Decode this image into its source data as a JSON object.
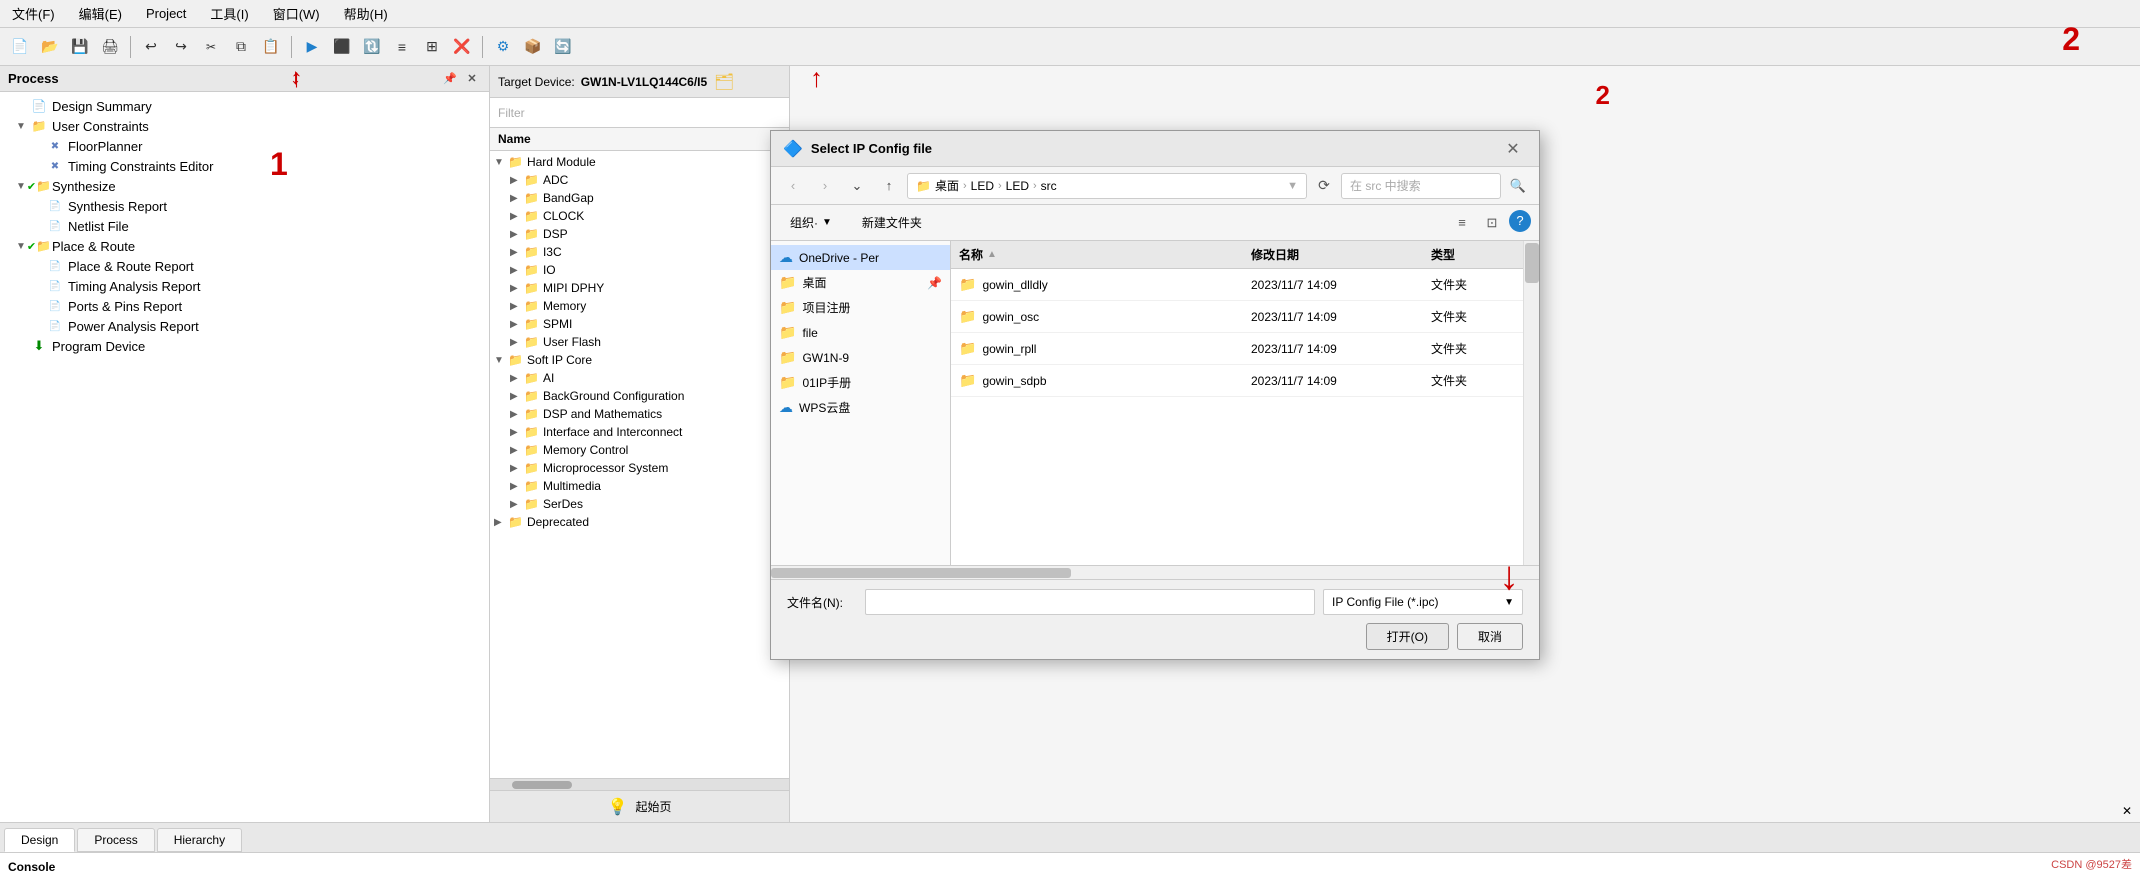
{
  "menu": {
    "items": [
      "文件(F)",
      "编辑(E)",
      "Project",
      "工具(I)",
      "窗口(W)",
      "帮助(H)"
    ]
  },
  "toolbar": {
    "buttons": [
      "📄",
      "📂",
      "💾",
      "🖨",
      "✂",
      "↩",
      "↪",
      "🔄",
      "🔲",
      "🔳",
      "📊",
      "📋",
      "❌",
      "⚙",
      "📦",
      "🔗",
      "🔃"
    ]
  },
  "left_panel": {
    "title": "Process",
    "tree": [
      {
        "id": "design-summary",
        "label": "Design Summary",
        "level": 1,
        "icon": "doc",
        "has_children": false
      },
      {
        "id": "user-constraints",
        "label": "User Constraints",
        "level": 1,
        "icon": "folder",
        "has_children": true,
        "expanded": true
      },
      {
        "id": "floorplanner",
        "label": "FloorPlanner",
        "level": 2,
        "icon": "file",
        "has_children": false
      },
      {
        "id": "timing-constraints",
        "label": "Timing Constraints Editor",
        "level": 2,
        "icon": "file",
        "has_children": false
      },
      {
        "id": "synthesize",
        "label": "Synthesize",
        "level": 1,
        "icon": "check_folder",
        "has_children": true,
        "expanded": true
      },
      {
        "id": "synthesis-report",
        "label": "Synthesis Report",
        "level": 2,
        "icon": "file",
        "has_children": false
      },
      {
        "id": "netlist-file",
        "label": "Netlist File",
        "level": 2,
        "icon": "file",
        "has_children": false
      },
      {
        "id": "place-route",
        "label": "Place & Route",
        "level": 1,
        "icon": "check_folder",
        "has_children": true,
        "expanded": true
      },
      {
        "id": "place-route-report",
        "label": "Place & Route Report",
        "level": 2,
        "icon": "file",
        "has_children": false
      },
      {
        "id": "timing-analysis",
        "label": "Timing Analysis Report",
        "level": 2,
        "icon": "file",
        "has_children": false
      },
      {
        "id": "ports-pins",
        "label": "Ports & Pins Report",
        "level": 2,
        "icon": "file",
        "has_children": false
      },
      {
        "id": "power-analysis",
        "label": "Power Analysis Report",
        "level": 2,
        "icon": "file",
        "has_children": false
      },
      {
        "id": "program-device",
        "label": "Program Device",
        "level": 1,
        "icon": "arrow_down",
        "has_children": false
      }
    ]
  },
  "ip_panel": {
    "target_device_label": "Target Device:",
    "target_device_value": "GW1N-LV1LQ144C6/I5",
    "filter_label": "Filter",
    "name_header": "Name",
    "tree": [
      {
        "id": "hard-module",
        "label": "Hard Module",
        "level": 0,
        "has_children": true,
        "expanded": true
      },
      {
        "id": "adc",
        "label": "ADC",
        "level": 1,
        "has_children": true
      },
      {
        "id": "bandgap",
        "label": "BandGap",
        "level": 1,
        "has_children": true
      },
      {
        "id": "clock",
        "label": "CLOCK",
        "level": 1,
        "has_children": true
      },
      {
        "id": "dsp",
        "label": "DSP",
        "level": 1,
        "has_children": true
      },
      {
        "id": "i3c",
        "label": "I3C",
        "level": 1,
        "has_children": true
      },
      {
        "id": "io",
        "label": "IO",
        "level": 1,
        "has_children": true
      },
      {
        "id": "mipi-dphy",
        "label": "MIPI DPHY",
        "level": 1,
        "has_children": true
      },
      {
        "id": "memory",
        "label": "Memory",
        "level": 1,
        "has_children": true
      },
      {
        "id": "spmi",
        "label": "SPMI",
        "level": 1,
        "has_children": true
      },
      {
        "id": "user-flash",
        "label": "User Flash",
        "level": 1,
        "has_children": true
      },
      {
        "id": "soft-ip-core",
        "label": "Soft IP Core",
        "level": 0,
        "has_children": true,
        "expanded": true
      },
      {
        "id": "ai",
        "label": "AI",
        "level": 1,
        "has_children": true
      },
      {
        "id": "background-config",
        "label": "BackGround Configuration",
        "level": 1,
        "has_children": true
      },
      {
        "id": "dsp-math",
        "label": "DSP and Mathematics",
        "level": 1,
        "has_children": true
      },
      {
        "id": "interface",
        "label": "Interface and Interconnect",
        "level": 1,
        "has_children": true
      },
      {
        "id": "memory-control",
        "label": "Memory Control",
        "level": 1,
        "has_children": true
      },
      {
        "id": "microprocessor",
        "label": "Microprocessor System",
        "level": 1,
        "has_children": true
      },
      {
        "id": "multimedia",
        "label": "Multimedia",
        "level": 1,
        "has_children": true
      },
      {
        "id": "serdes",
        "label": "SerDes",
        "level": 1,
        "has_children": true
      },
      {
        "id": "deprecated",
        "label": "Deprecated",
        "level": 0,
        "has_children": true
      }
    ],
    "status": "起始页"
  },
  "dialog": {
    "title": "Select IP Config file",
    "breadcrumb": [
      "桌面",
      "LED",
      "LED",
      "src"
    ],
    "breadcrumb_separator": "›",
    "search_placeholder": "在 src 中搜索",
    "toolbar_organize": "组织·",
    "toolbar_newfolder": "新建文件夹",
    "nav_back": "‹",
    "nav_forward": "›",
    "nav_down": "⌄",
    "nav_up": "↑",
    "refresh": "⟳",
    "left_nav": [
      {
        "id": "onedrive",
        "label": "OneDrive - Per",
        "icon": "cloud"
      },
      {
        "id": "desktop",
        "label": "桌面",
        "icon": "folder",
        "pinned": true
      },
      {
        "id": "zhuangzhu",
        "label": "项目注册",
        "icon": "folder"
      },
      {
        "id": "file",
        "label": "file",
        "icon": "folder"
      },
      {
        "id": "gw1n9",
        "label": "GW1N-9",
        "icon": "folder"
      },
      {
        "id": "ip-manual",
        "label": "01IP手册",
        "icon": "folder"
      },
      {
        "id": "wps",
        "label": "WPS云盘",
        "icon": "cloud"
      }
    ],
    "files_header": {
      "name": "名称",
      "date": "修改日期",
      "type": "类型"
    },
    "files": [
      {
        "id": "gowin-dlldly",
        "name": "gowin_dlldly",
        "date": "2023/11/7 14:09",
        "type": "文件夹"
      },
      {
        "id": "gowin-osc",
        "name": "gowin_osc",
        "date": "2023/11/7 14:09",
        "type": "文件夹"
      },
      {
        "id": "gowin-rpll",
        "name": "gowin_rpll",
        "date": "2023/11/7 14:09",
        "type": "文件夹"
      },
      {
        "id": "gowin-sdpb",
        "name": "gowin_sdpb",
        "date": "2023/11/7 14:09",
        "type": "文件夹"
      }
    ],
    "filename_label": "文件名(N):",
    "filetype_label": "IP Config File (*.ipc)",
    "btn_open": "打开(O)",
    "btn_cancel": "取消"
  },
  "bottom_tabs": [
    "Design",
    "Process",
    "Hierarchy"
  ],
  "console_label": "Console",
  "annotations": {
    "label_1": "1",
    "label_2": "2"
  }
}
